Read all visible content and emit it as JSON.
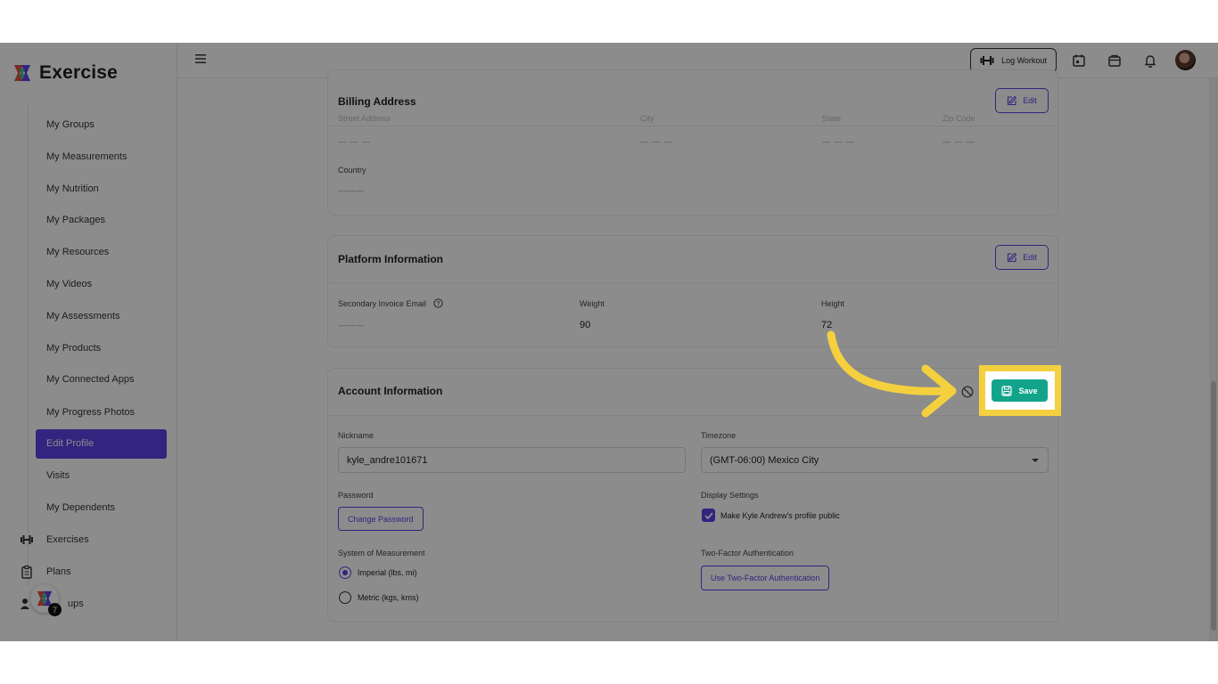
{
  "app": {
    "name": "Exercise"
  },
  "sidebar": {
    "sub_items": [
      {
        "label": "My Groups"
      },
      {
        "label": "My Measurements"
      },
      {
        "label": "My Nutrition"
      },
      {
        "label": "My Packages"
      },
      {
        "label": "My Resources"
      },
      {
        "label": "My Videos"
      },
      {
        "label": "My Assessments"
      },
      {
        "label": "My Products"
      },
      {
        "label": "My Connected Apps"
      },
      {
        "label": "My Progress Photos"
      },
      {
        "label": "Edit Profile",
        "active": true
      },
      {
        "label": "Visits"
      },
      {
        "label": "My Dependents"
      }
    ],
    "main_items": [
      {
        "label": "Exercises",
        "icon": "dumbbell-icon"
      },
      {
        "label": "Plans",
        "icon": "clipboard-icon"
      },
      {
        "label": "ups",
        "icon": "groups-icon"
      }
    ],
    "fab_badge": "7"
  },
  "topbar": {
    "log_workout_label": "Log Workout"
  },
  "billing": {
    "title": "Billing Address",
    "edit_label": "Edit",
    "fields": [
      "Street Address",
      "City",
      "State",
      "Zip Code"
    ],
    "empty_value": "— — —",
    "country_label": "Country",
    "country_value": "———"
  },
  "platform": {
    "title": "Platform Information",
    "edit_label": "Edit",
    "secondary_email_label": "Secondary Invoice Email",
    "secondary_email_value": "———",
    "weight_label": "Weight",
    "weight_value": "90",
    "height_label": "Height",
    "height_value": "72"
  },
  "account": {
    "title": "Account Information",
    "save_label": "Save",
    "nickname_label": "Nickname",
    "nickname_value": "kyle_andre101671",
    "timezone_label": "Timezone",
    "timezone_value": "(GMT-06:00) Mexico City",
    "password_label": "Password",
    "change_password_label": "Change Password",
    "display_settings_label": "Display Settings",
    "public_profile_label": "Make Kyle Andrew's profile public",
    "public_profile_checked": true,
    "measurement_label": "System of Measurement",
    "imperial_label": "Imperial (lbs, mi)",
    "metric_label": "Metric (kgs, kms)",
    "measurement_selected": "Imperial (lbs, mi)",
    "two_factor_label": "Two-Factor Authentication",
    "two_factor_button_label": "Use Two-Factor Authentication"
  },
  "colors": {
    "accent": "#5b43e8",
    "save": "#12a48b",
    "highlight": "#f4d03f"
  }
}
